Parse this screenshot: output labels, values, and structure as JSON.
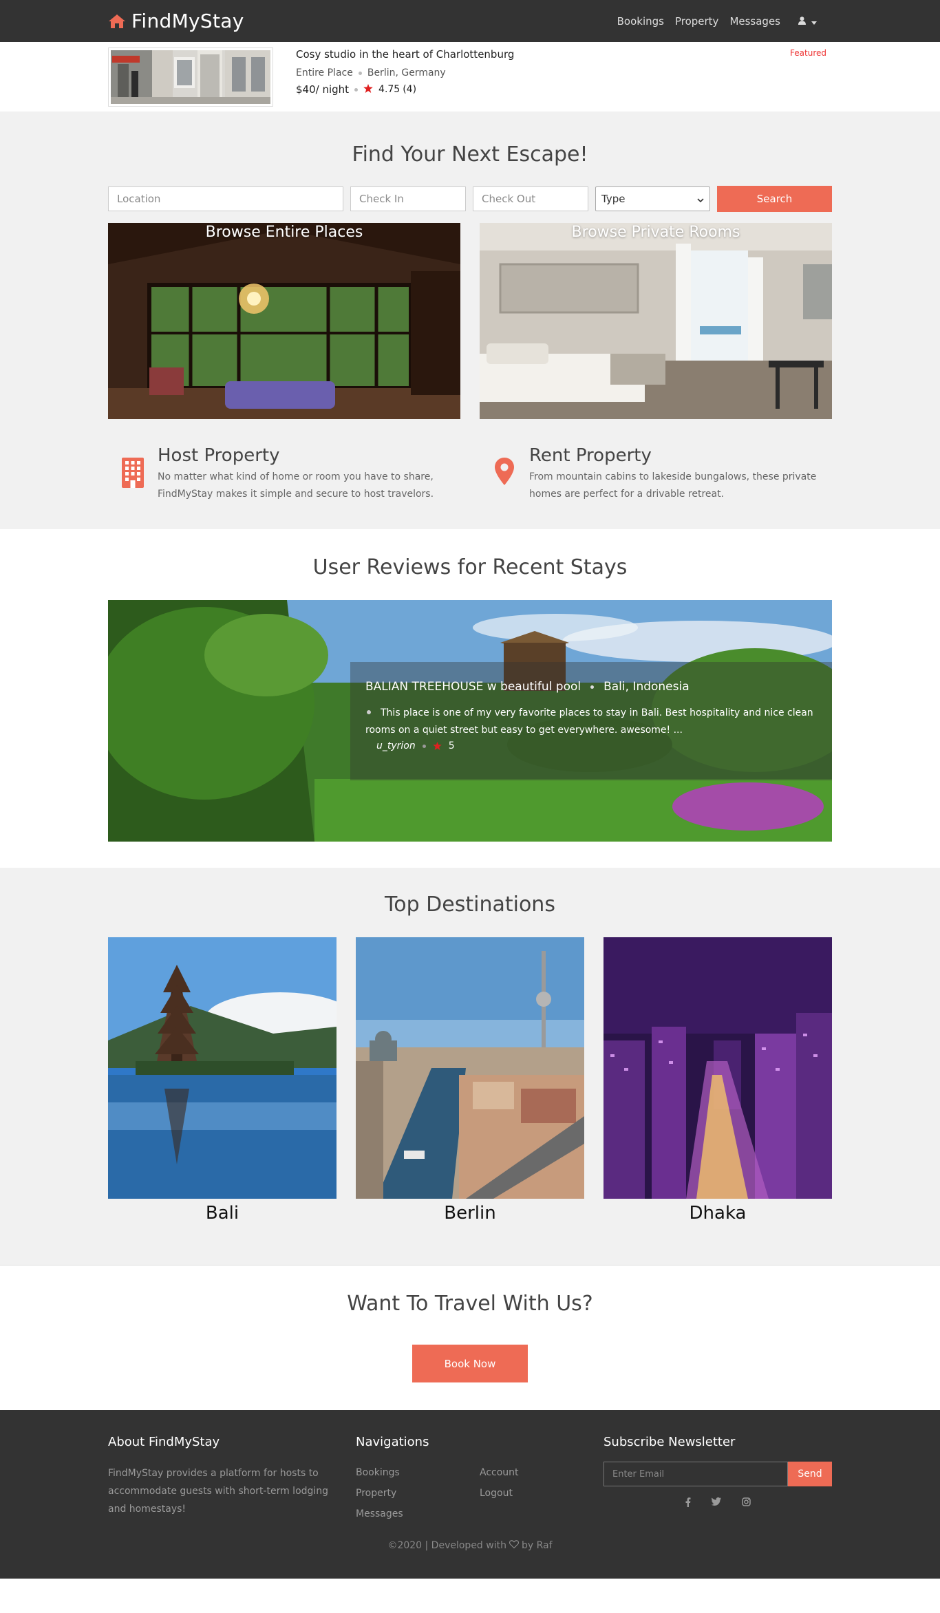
{
  "navbar": {
    "brand": "FindMyStay",
    "brand_icon": "home-icon",
    "links": [
      "Bookings",
      "Property",
      "Messages"
    ],
    "user_icon": "user-icon",
    "dropdown_icon": "caret-down-icon"
  },
  "featured": {
    "title": "Cosy studio in the heart of Charlottenburg",
    "type": "Entire Place",
    "location": "Berlin, Germany",
    "price": "$40/ night",
    "rating": "4.75",
    "reviews": "(4)",
    "badge": "Featured"
  },
  "hero": {
    "title": "Find Your Next Escape!",
    "location_placeholder": "Location",
    "checkin_placeholder": "Check In",
    "checkout_placeholder": "Check Out",
    "type_value": "Type",
    "search_label": "Search",
    "browse_entire": "Browse Entire Places",
    "browse_private": "Browse Private Rooms"
  },
  "features": {
    "host_title": "Host Property",
    "host_desc": "No matter what kind of home or room you have to share, FindMyStay makes it simple and secure to host travelors.",
    "rent_title": "Rent Property",
    "rent_desc": "From mountain cabins to lakeside bungalows, these private homes are perfect for a drivable retreat."
  },
  "reviews": {
    "title": "User Reviews for Recent Stays",
    "listing": "BALIAN TREEHOUSE w beautiful pool",
    "location": "Bali, Indonesia",
    "text": "This place is one of my very favorite places to stay in Bali. Best hospitality and nice clean rooms on a quiet street but easy to get everywhere.  awesome! ...",
    "user": "u_tyrion",
    "rating": "5"
  },
  "destinations": {
    "title": "Top Destinations",
    "items": [
      "Bali",
      "Berlin",
      "Dhaka"
    ]
  },
  "cta": {
    "title": "Want To Travel With Us?",
    "button": "Book Now"
  },
  "footer": {
    "about_title": "About FindMyStay",
    "about_text": "FindMyStay provides a platform for hosts to accommodate guests with short-term lodging and homestays!",
    "nav_title": "Navigations",
    "nav_links": [
      "Bookings",
      "Account",
      "Property",
      "Logout",
      "Messages"
    ],
    "newsletter_title": "Subscribe Newsletter",
    "email_placeholder": "Enter Email",
    "send_label": "Send",
    "copyright_prefix": "©2020 | Developed with",
    "copyright_suffix": "by Raf"
  },
  "colors": {
    "accent": "#ee6b55",
    "navbar": "#333333",
    "star": "#e02020"
  }
}
